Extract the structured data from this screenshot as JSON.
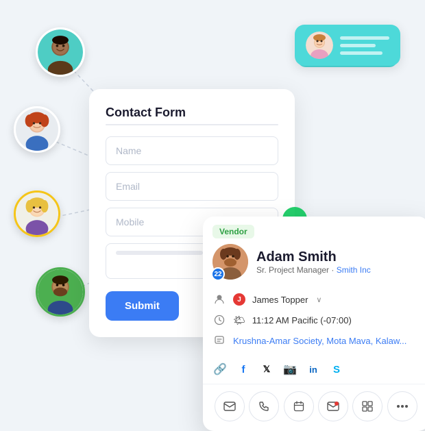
{
  "page": {
    "background_color": "#f0f4f8"
  },
  "contact_form": {
    "title": "Contact Form",
    "fields": [
      {
        "placeholder": "Name",
        "type": "text"
      },
      {
        "placeholder": "Email",
        "type": "email"
      },
      {
        "placeholder": "Mobile",
        "type": "tel"
      },
      {
        "placeholder": "",
        "type": "textarea"
      }
    ],
    "submit_label": "Submit"
  },
  "profile_card": {
    "vendor_label": "Vendor",
    "name": "Adam Smith",
    "title": "Sr. Project Manager",
    "company": "Smith Inc",
    "badge_count": "22",
    "contact_person": "James Topper",
    "time": "11:12 AM Pacific (-07:00)",
    "location": "Krushna-Amar Society, Mota Mava, Kalaw...",
    "social_icons": [
      "link",
      "facebook",
      "x",
      "instagram",
      "linkedin",
      "skype"
    ],
    "action_icons": [
      "email",
      "phone",
      "calendar",
      "envelope",
      "grid",
      "more"
    ]
  },
  "top_right_card": {
    "teal_lines": [
      70,
      50,
      60
    ]
  }
}
